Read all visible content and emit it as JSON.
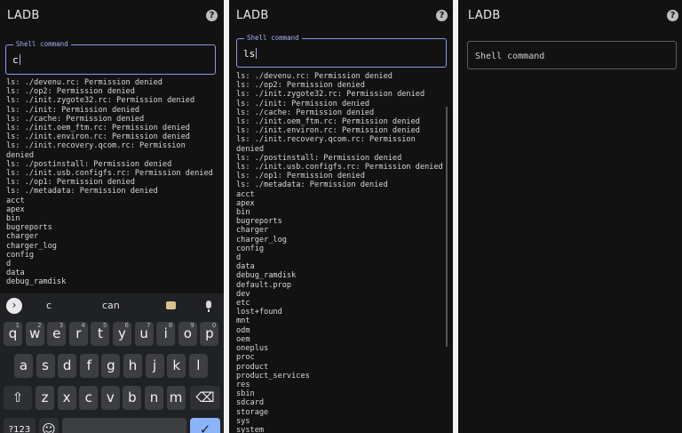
{
  "app": {
    "title": "LADB",
    "help_glyph": "?"
  },
  "panel1": {
    "input_label": "Shell command",
    "input_value": "c",
    "output": [
      "ls: ./devenu.rc: Permission denied",
      "ls: ./op2: Permission denied",
      "ls: ./init.zygote32.rc: Permission denied",
      "ls: ./init: Permission denied",
      "ls: ./cache: Permission denied",
      "ls: ./init.oem_ftm.rc: Permission denied",
      "ls: ./init.environ.rc: Permission denied",
      "ls: ./init.recovery.qcom.rc: Permission",
      "denied",
      "ls: ./postinstall: Permission denied",
      "ls: ./init.usb.configfs.rc: Permission denied",
      "ls: ./op1: Permission denied",
      "ls: ./metadata: Permission denied",
      "acct",
      "apex",
      "bin",
      "bugreports",
      "charger",
      "charger_log",
      "config",
      "d",
      "data",
      "debug_ramdisk"
    ]
  },
  "panel2": {
    "input_label": "Shell command",
    "input_value": "ls",
    "output": [
      "ls: ./devenu.rc: Permission denied",
      "ls: ./op2: Permission denied",
      "ls: ./init.zygote32.rc: Permission denied",
      "ls: ./init: Permission denied",
      "ls: ./cache: Permission denied",
      "ls: ./init.oem_ftm.rc: Permission denied",
      "ls: ./init.environ.rc: Permission denied",
      "ls: ./init.recovery.qcom.rc: Permission",
      "denied",
      "ls: ./postinstall: Permission denied",
      "ls: ./init.usb.configfs.rc: Permission denied",
      "ls: ./op1: Permission denied",
      "ls: ./metadata: Permission denied",
      "acct",
      "apex",
      "bin",
      "bugreports",
      "charger",
      "charger_log",
      "config",
      "d",
      "data",
      "debug_ramdisk",
      "default.prop",
      "dev",
      "etc",
      "lost+found",
      "mnt",
      "odm",
      "oem",
      "oneplus",
      "proc",
      "product",
      "product_services",
      "res",
      "sbin",
      "sdcard",
      "storage",
      "sys",
      "system"
    ]
  },
  "panel3": {
    "input_placeholder": "Shell command"
  },
  "keyboard": {
    "suggestions": [
      "c",
      "can"
    ],
    "row1": [
      {
        "k": "q",
        "h": "1"
      },
      {
        "k": "w",
        "h": "2"
      },
      {
        "k": "e",
        "h": "3"
      },
      {
        "k": "r",
        "h": "4"
      },
      {
        "k": "t",
        "h": "5"
      },
      {
        "k": "y",
        "h": "6"
      },
      {
        "k": "u",
        "h": "7"
      },
      {
        "k": "i",
        "h": "8"
      },
      {
        "k": "o",
        "h": "9"
      },
      {
        "k": "p",
        "h": "0"
      }
    ],
    "row2": [
      "a",
      "s",
      "d",
      "f",
      "g",
      "h",
      "j",
      "k",
      "l"
    ],
    "row3": [
      "z",
      "x",
      "c",
      "v",
      "b",
      "n",
      "m"
    ],
    "shift_glyph": "⇧",
    "backspace_glyph": "⌫",
    "symbols_label": "?123",
    "emoji_glyph": "☺",
    "enter_glyph": "✓"
  },
  "colors": {
    "background": "#121212",
    "accent": "#8a9af0",
    "keyboard": "#1f2124",
    "key": "#3c3e42",
    "enter_key": "#8ab4f8"
  }
}
